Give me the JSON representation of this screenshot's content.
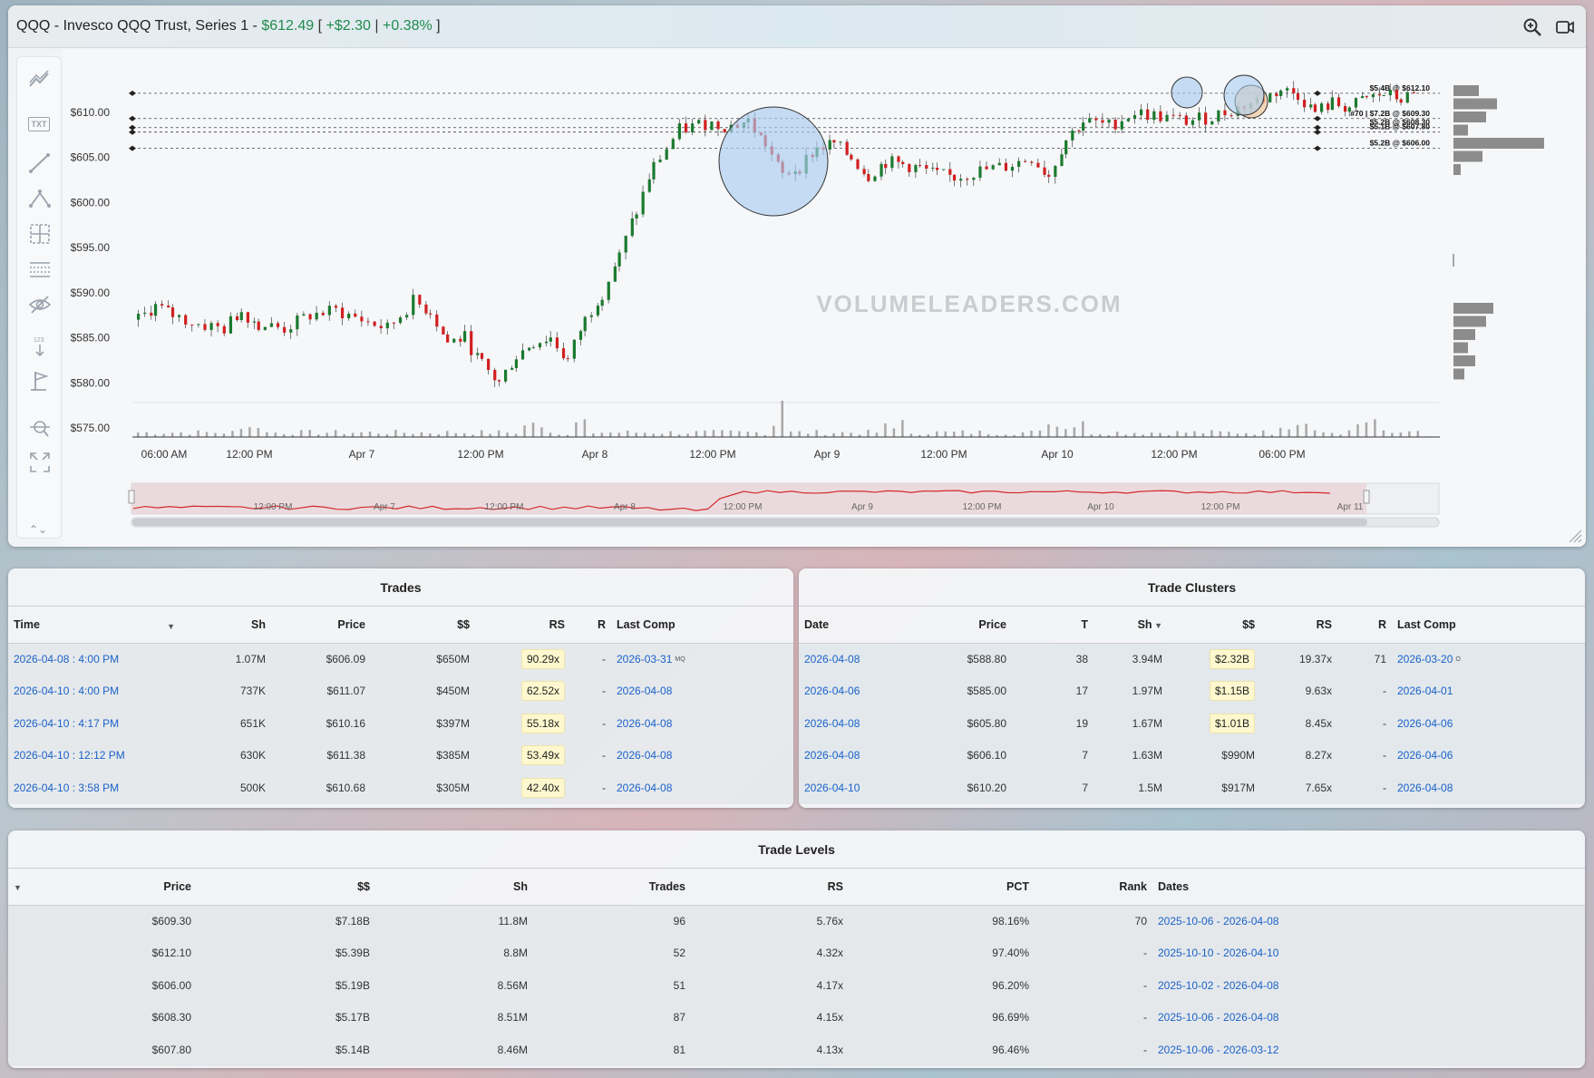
{
  "header": {
    "symbol": "QQQ",
    "name": "Invesco QQQ Trust, Series 1",
    "dash": "-",
    "price": "$612.49",
    "bracket_open": "[",
    "change": "+$2.30",
    "pipe": "|",
    "change_pct": "+0.38%",
    "bracket_close": "]"
  },
  "toolbar": {
    "txt_label": "TXT",
    "num_label": "123"
  },
  "watermark": "VOLUMELEADERS.COM",
  "colors": {
    "up": "#1a7a2e",
    "down": "#d21f1f",
    "link": "#1a62c9",
    "positive": "#1f8a4c",
    "bubble_blue": "#a9cdf0",
    "bubble_orange": "#f2c79c"
  },
  "chart_data": {
    "type": "candlestick",
    "ylim": [
      574,
      614
    ],
    "y_ticks": [
      "$610.00",
      "$605.00",
      "$600.00",
      "$595.00",
      "$590.00",
      "$585.00",
      "$580.00",
      "$575.00"
    ],
    "y_tick_values": [
      610,
      605,
      600,
      595,
      590,
      585,
      580,
      575
    ],
    "x_ticks": [
      "06:00 AM",
      "12:00 PM",
      "Apr 7",
      "12:00 PM",
      "Apr 8",
      "12:00 PM",
      "Apr 9",
      "12:00 PM",
      "Apr 10",
      "12:00 PM",
      "06:00 PM"
    ],
    "levels": [
      {
        "price": 612.1,
        "label": "$5.4B @ $612.10"
      },
      {
        "price": 609.3,
        "label": "#70 | $7.2B @ $609.30"
      },
      {
        "price": 608.3,
        "label": "$5.2B @ $608.30"
      },
      {
        "price": 607.8,
        "label": "$5.1B @ $607.80"
      },
      {
        "price": 606.0,
        "label": "$5.2B @ $606.00"
      }
    ],
    "price_path": [
      [
        0,
        587
      ],
      [
        4,
        588.5
      ],
      [
        8,
        587.5
      ],
      [
        14,
        586.5
      ],
      [
        20,
        586
      ],
      [
        24,
        588
      ],
      [
        28,
        586.5
      ],
      [
        34,
        586
      ],
      [
        40,
        587.5
      ],
      [
        46,
        588
      ],
      [
        52,
        587
      ],
      [
        58,
        586
      ],
      [
        64,
        589
      ],
      [
        68,
        588
      ],
      [
        72,
        584.5
      ],
      [
        76,
        585
      ],
      [
        80,
        582
      ],
      [
        84,
        580
      ],
      [
        88,
        583
      ],
      [
        92,
        584.5
      ],
      [
        96,
        585
      ],
      [
        100,
        582.5
      ],
      [
        104,
        587
      ],
      [
        108,
        590
      ],
      [
        112,
        594
      ],
      [
        116,
        599
      ],
      [
        120,
        604
      ],
      [
        126,
        608
      ],
      [
        132,
        608.8
      ],
      [
        138,
        608.5
      ],
      [
        142,
        609
      ],
      [
        146,
        606.5
      ],
      [
        150,
        603
      ],
      [
        154,
        604
      ],
      [
        158,
        606
      ],
      [
        162,
        606.5
      ],
      [
        166,
        605
      ],
      [
        170,
        603
      ],
      [
        174,
        604.5
      ],
      [
        178,
        604.2
      ],
      [
        182,
        603.8
      ],
      [
        186,
        603
      ],
      [
        190,
        602.8
      ],
      [
        196,
        603.5
      ],
      [
        202,
        604
      ],
      [
        208,
        605
      ],
      [
        212,
        603
      ],
      [
        216,
        607
      ],
      [
        220,
        609
      ],
      [
        226,
        608.5
      ],
      [
        232,
        610
      ],
      [
        238,
        609.5
      ],
      [
        244,
        609
      ],
      [
        250,
        609.5
      ],
      [
        256,
        610.5
      ],
      [
        262,
        611.5
      ],
      [
        266,
        612.5
      ],
      [
        270,
        612
      ],
      [
        274,
        610
      ],
      [
        278,
        611
      ],
      [
        282,
        610.5
      ],
      [
        286,
        611.5
      ],
      [
        290,
        612
      ],
      [
        294,
        611.5
      ],
      [
        298,
        611.8
      ]
    ],
    "volume_profile_top": [
      7,
      12,
      9,
      4,
      25,
      8,
      2
    ],
    "volume_profile_bottom": [
      11,
      9,
      6,
      4,
      6,
      3
    ],
    "navigator_labels": [
      "12:00 PM",
      "Apr 7",
      "12:00 PM",
      "Apr 8",
      "12:00 PM",
      "Apr 9",
      "12:00 PM",
      "Apr 10",
      "12:00 PM",
      "Apr 11"
    ]
  },
  "trades": {
    "title": "Trades",
    "columns": [
      "Time",
      "Sh",
      "Price",
      "$$",
      "RS",
      "R",
      "Last Comp"
    ],
    "rows": [
      {
        "time": "2026-04-08 : 4:00 PM",
        "sh": "1.07M",
        "price": "$606.09",
        "dollars": "$650M",
        "rs": "90.29x",
        "r": "-",
        "last": "2026-03-31",
        "tag": "MQ"
      },
      {
        "time": "2026-04-10 : 4:00 PM",
        "sh": "737K",
        "price": "$611.07",
        "dollars": "$450M",
        "rs": "62.52x",
        "r": "-",
        "last": "2026-04-08",
        "tag": ""
      },
      {
        "time": "2026-04-10 : 4:17 PM",
        "sh": "651K",
        "price": "$610.16",
        "dollars": "$397M",
        "rs": "55.18x",
        "r": "-",
        "last": "2026-04-08",
        "tag": ""
      },
      {
        "time": "2026-04-10 : 12:12 PM",
        "sh": "630K",
        "price": "$611.38",
        "dollars": "$385M",
        "rs": "53.49x",
        "r": "-",
        "last": "2026-04-08",
        "tag": ""
      },
      {
        "time": "2026-04-10 : 3:58 PM",
        "sh": "500K",
        "price": "$610.68",
        "dollars": "$305M",
        "rs": "42.40x",
        "r": "-",
        "last": "2026-04-08",
        "tag": ""
      }
    ]
  },
  "clusters": {
    "title": "Trade Clusters",
    "columns": [
      "Date",
      "Price",
      "T",
      "Sh",
      "$$",
      "RS",
      "R",
      "Last Comp"
    ],
    "rows": [
      {
        "date": "2026-04-08",
        "price": "$588.80",
        "t": "38",
        "sh": "3.94M",
        "dollars": "$2.32B",
        "hl": true,
        "rs": "19.37x",
        "r": "71",
        "last": "2026-03-20",
        "tag": "O"
      },
      {
        "date": "2026-04-06",
        "price": "$585.00",
        "t": "17",
        "sh": "1.97M",
        "dollars": "$1.15B",
        "hl": true,
        "rs": "9.63x",
        "r": "-",
        "last": "2026-04-01",
        "tag": ""
      },
      {
        "date": "2026-04-08",
        "price": "$605.80",
        "t": "19",
        "sh": "1.67M",
        "dollars": "$1.01B",
        "hl": true,
        "rs": "8.45x",
        "r": "-",
        "last": "2026-04-06",
        "tag": ""
      },
      {
        "date": "2026-04-08",
        "price": "$606.10",
        "t": "7",
        "sh": "1.63M",
        "dollars": "$990M",
        "hl": false,
        "rs": "8.27x",
        "r": "-",
        "last": "2026-04-06",
        "tag": ""
      },
      {
        "date": "2026-04-10",
        "price": "$610.20",
        "t": "7",
        "sh": "1.5M",
        "dollars": "$917M",
        "hl": false,
        "rs": "7.65x",
        "r": "-",
        "last": "2026-04-08",
        "tag": ""
      }
    ]
  },
  "levels": {
    "title": "Trade Levels",
    "columns": [
      "Price",
      "$$",
      "Sh",
      "Trades",
      "RS",
      "PCT",
      "Rank",
      "Dates"
    ],
    "rows": [
      {
        "price": "$609.30",
        "dollars": "$7.18B",
        "sh": "11.8M",
        "trades": "96",
        "rs": "5.76x",
        "pct": "98.16%",
        "rank": "70",
        "dates": "2025-10-06 - 2026-04-08"
      },
      {
        "price": "$612.10",
        "dollars": "$5.39B",
        "sh": "8.8M",
        "trades": "52",
        "rs": "4.32x",
        "pct": "97.40%",
        "rank": "-",
        "dates": "2025-10-10 - 2026-04-10"
      },
      {
        "price": "$606.00",
        "dollars": "$5.19B",
        "sh": "8.56M",
        "trades": "51",
        "rs": "4.17x",
        "pct": "96.20%",
        "rank": "-",
        "dates": "2025-10-02 - 2026-04-08"
      },
      {
        "price": "$608.30",
        "dollars": "$5.17B",
        "sh": "8.51M",
        "trades": "87",
        "rs": "4.15x",
        "pct": "96.69%",
        "rank": "-",
        "dates": "2025-10-06 - 2026-04-08"
      },
      {
        "price": "$607.80",
        "dollars": "$5.14B",
        "sh": "8.46M",
        "trades": "81",
        "rs": "4.13x",
        "pct": "96.46%",
        "rank": "-",
        "dates": "2025-10-06 - 2026-03-12"
      }
    ]
  }
}
